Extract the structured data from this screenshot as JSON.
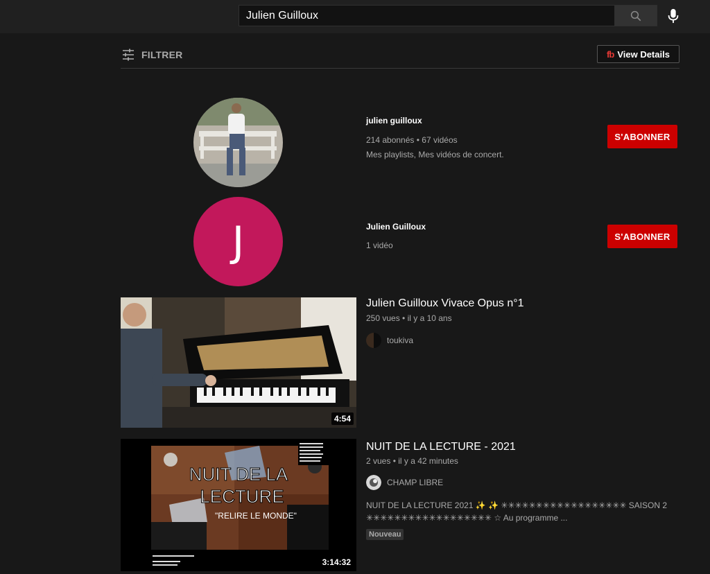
{
  "search": {
    "query": "Julien Guilloux"
  },
  "filter": {
    "label": "FILTRER"
  },
  "view_details": {
    "logo": "fb",
    "label": "View Details"
  },
  "channels": [
    {
      "name": "julien guilloux",
      "stats": "214 abonnés • 67 vidéos",
      "description": "Mes playlists, Mes vidéos de concert.",
      "subscribe_label": "S'ABONNER"
    },
    {
      "name": "Julien Guilloux",
      "avatar_letter": "J",
      "avatar_color": "#c2185b",
      "stats": "1 vidéo",
      "subscribe_label": "S'ABONNER"
    }
  ],
  "videos": [
    {
      "title": "Julien Guilloux Vivace Opus n°1",
      "meta": "250 vues • il y a 10 ans",
      "channel": "toukiva",
      "duration": "4:54"
    },
    {
      "title": "NUIT DE LA LECTURE - 2021",
      "meta": "2 vues • il y a 42 minutes",
      "channel": "CHAMP LIBRE",
      "description": "NUIT DE LA LECTURE 2021 ✨ ✨ ✳✳✳✳✳✳✳✳✳✳✳✳✳✳✳✳✳✳ SAISON 2 ✳✳✳✳✳✳✳✳✳✳✳✳✳✳✳✳✳✳ ☆ Au programme ...",
      "badge": "Nouveau",
      "duration": "3:14:32",
      "thumb_text": {
        "line1": "NUIT DE LA",
        "line2": "LECTURE",
        "line3": "\"RELIRE LE MONDE\""
      }
    }
  ],
  "colors": {
    "background": "#181818",
    "topbar": "#202020",
    "subscribe": "#cc0000",
    "muted_text": "#aaaaaa"
  }
}
